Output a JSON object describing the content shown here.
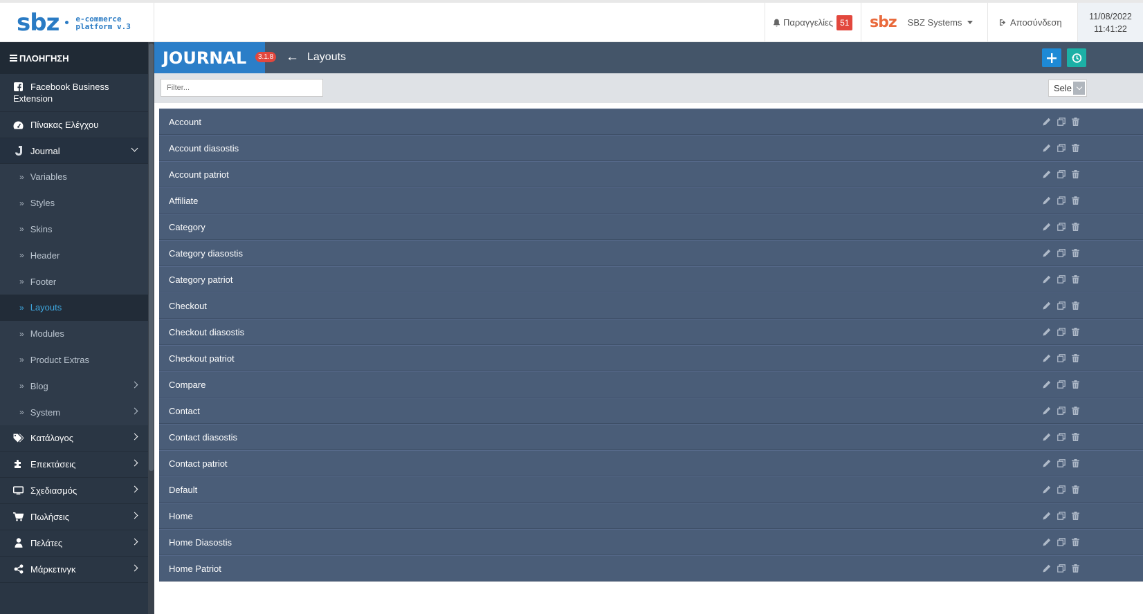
{
  "header": {
    "logo_text": "sbz",
    "logo_tag_line1": "e-commerce",
    "logo_tag_line2": "platform v.3",
    "orders_label": "Παραγγελίες",
    "orders_count": "51",
    "store_logo": "sbz",
    "store_name": "SBZ Systems",
    "logout_label": "Αποσύνδεση",
    "date": "11/08/2022",
    "time": "11:41:22"
  },
  "sidebar": {
    "nav_title": "ΠΛΟΗΓΗΣΗ",
    "items": [
      {
        "label": "Facebook Business Extension",
        "icon": "facebook-icon"
      },
      {
        "label": "Πίνακας Ελέγχου",
        "icon": "dashboard-icon"
      },
      {
        "label": "Journal",
        "icon": "journal-icon"
      }
    ],
    "journal_sub": [
      {
        "label": "Variables"
      },
      {
        "label": "Styles"
      },
      {
        "label": "Skins"
      },
      {
        "label": "Header"
      },
      {
        "label": "Footer"
      },
      {
        "label": "Layouts"
      },
      {
        "label": "Modules"
      },
      {
        "label": "Product Extras"
      },
      {
        "label": "Blog"
      },
      {
        "label": "System"
      }
    ],
    "bottom_items": [
      {
        "label": "Κατάλογος",
        "icon": "tag-icon"
      },
      {
        "label": "Επεκτάσεις",
        "icon": "puzzle-icon"
      },
      {
        "label": "Σχεδιασμός",
        "icon": "monitor-icon"
      },
      {
        "label": "Πωλήσεις",
        "icon": "cart-icon"
      },
      {
        "label": "Πελάτες",
        "icon": "user-icon"
      },
      {
        "label": "Μάρκετινγκ",
        "icon": "share-icon"
      }
    ],
    "active_item": "Layouts"
  },
  "main": {
    "brand": "JOURNAL",
    "version": "3.1.8",
    "page_title": "Layouts",
    "filter_placeholder": "Filter...",
    "select_value": "Sele",
    "layouts": [
      "Account",
      "Account diasostis",
      "Account patriot",
      "Affiliate",
      "Category",
      "Category diasostis",
      "Category patriot",
      "Checkout",
      "Checkout diasostis",
      "Checkout patriot",
      "Compare",
      "Contact",
      "Contact diasostis",
      "Contact patriot",
      "Default",
      "Home",
      "Home Diasostis",
      "Home Patriot"
    ]
  },
  "colors": {
    "sidebar_bg": "#2a3644",
    "active_link": "#3fa8e0",
    "journal_blue": "#2b7ec8",
    "row_bg": "#4a5d78",
    "badge_red": "#e2473d"
  }
}
